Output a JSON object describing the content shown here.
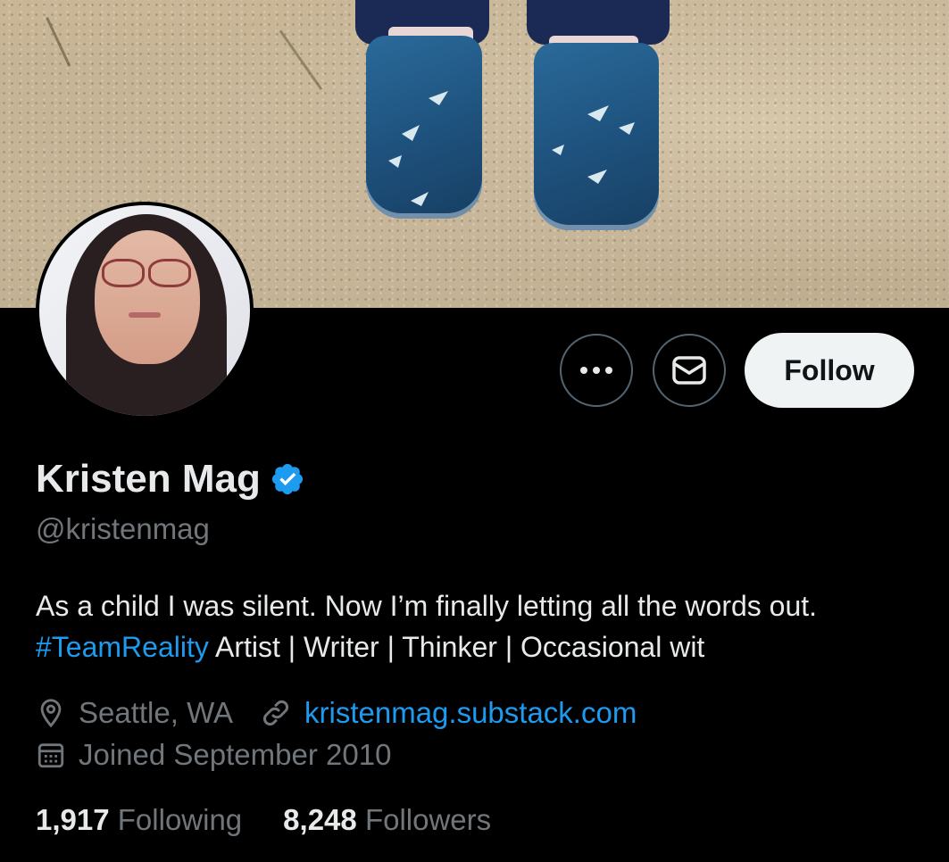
{
  "profile": {
    "name": "Kristen Mag",
    "handle": "@kristenmag",
    "bio_line1": "As a child I was silent. Now I’m finally letting all the words out.",
    "bio_hashtag": "#TeamReality",
    "bio_rest": " Artist | Writer | Thinker | Occasional wit",
    "location": "Seattle, WA",
    "website": "kristenmag.substack.com",
    "joined": "Joined September 2010",
    "verified": true
  },
  "actions": {
    "more_icon": "ellipsis-icon",
    "message_icon": "envelope-icon",
    "follow_label": "Follow"
  },
  "stats": {
    "following_count": "1,917",
    "following_label": "Following",
    "followers_count": "8,248",
    "followers_label": "Followers"
  },
  "colors": {
    "accent": "#1d9bf0",
    "muted": "#71767b",
    "background": "#000000",
    "text": "#e7e9ea"
  }
}
